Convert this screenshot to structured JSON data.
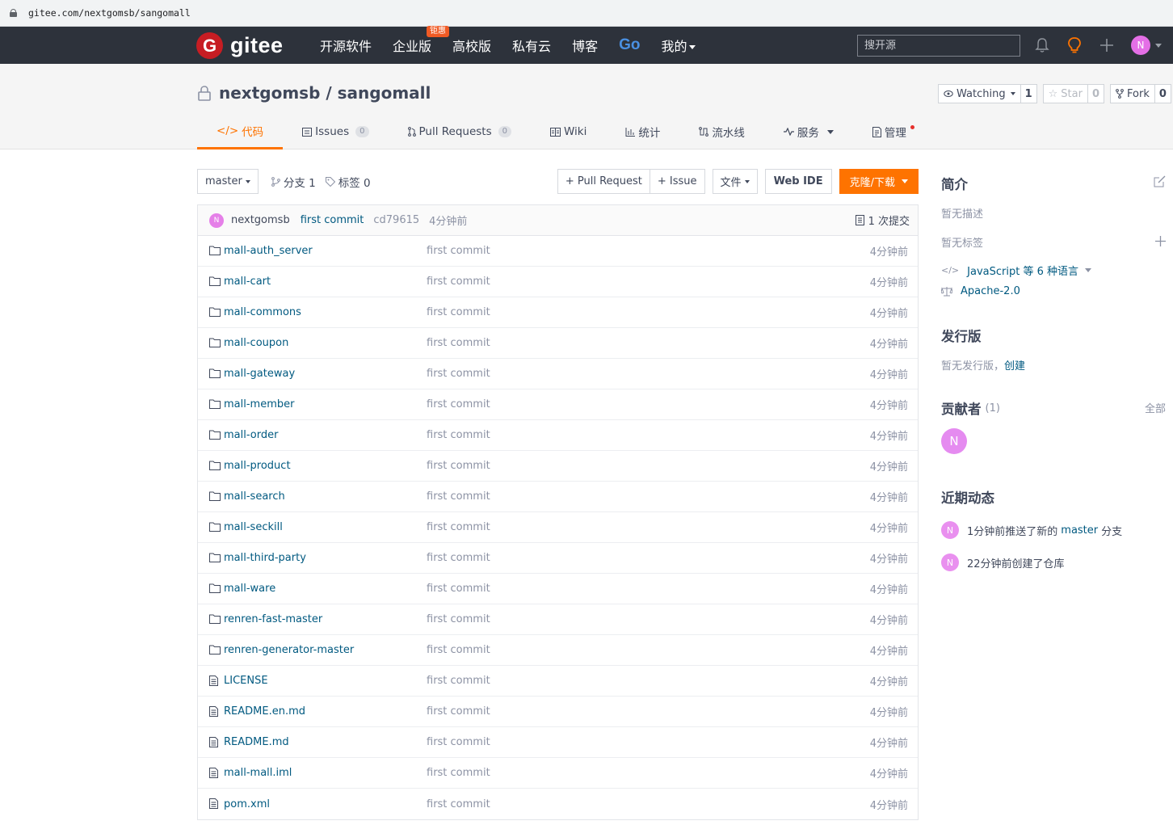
{
  "browser": {
    "url": "gitee.com/nextgomsb/sangomall"
  },
  "nav": {
    "logo_letter": "G",
    "logo_text": "gitee",
    "links": [
      "开源软件",
      "企业版",
      "高校版",
      "私有云",
      "博客",
      "Go",
      "我的"
    ],
    "enterprise_badge": "钜惠",
    "search_placeholder": "搜开源",
    "avatar_letter": "N"
  },
  "repo": {
    "owner": "nextgomsb",
    "separator": " / ",
    "name": "sangomall",
    "watch": {
      "label": "Watching",
      "count": "1"
    },
    "star": {
      "label": "Star",
      "count": "0"
    },
    "fork": {
      "label": "Fork",
      "count": "0"
    }
  },
  "tabs": [
    {
      "label": "代码"
    },
    {
      "label": "Issues",
      "count": "0"
    },
    {
      "label": "Pull Requests",
      "count": "0"
    },
    {
      "label": "Wiki"
    },
    {
      "label": "统计"
    },
    {
      "label": "流水线"
    },
    {
      "label": "服务"
    },
    {
      "label": "管理"
    }
  ],
  "toolbar": {
    "branch": "master",
    "branches": "分支 1",
    "tags": "标签 0",
    "pull_request": "+ Pull Request",
    "issue": "+ Issue",
    "file": "文件",
    "web_ide": "Web IDE",
    "clone": "克隆/下载"
  },
  "commit": {
    "avatar_letter": "N",
    "author": "nextgomsb",
    "message": "first commit",
    "sha": "cd79615",
    "time": "4分钟前",
    "count": "1 次提交"
  },
  "files": [
    {
      "name": "mall-auth_server",
      "type": "folder",
      "message": "first commit",
      "time": "4分钟前"
    },
    {
      "name": "mall-cart",
      "type": "folder",
      "message": "first commit",
      "time": "4分钟前"
    },
    {
      "name": "mall-commons",
      "type": "folder",
      "message": "first commit",
      "time": "4分钟前"
    },
    {
      "name": "mall-coupon",
      "type": "folder",
      "message": "first commit",
      "time": "4分钟前"
    },
    {
      "name": "mall-gateway",
      "type": "folder",
      "message": "first commit",
      "time": "4分钟前"
    },
    {
      "name": "mall-member",
      "type": "folder",
      "message": "first commit",
      "time": "4分钟前"
    },
    {
      "name": "mall-order",
      "type": "folder",
      "message": "first commit",
      "time": "4分钟前"
    },
    {
      "name": "mall-product",
      "type": "folder",
      "message": "first commit",
      "time": "4分钟前"
    },
    {
      "name": "mall-search",
      "type": "folder",
      "message": "first commit",
      "time": "4分钟前"
    },
    {
      "name": "mall-seckill",
      "type": "folder",
      "message": "first commit",
      "time": "4分钟前"
    },
    {
      "name": "mall-third-party",
      "type": "folder",
      "message": "first commit",
      "time": "4分钟前"
    },
    {
      "name": "mall-ware",
      "type": "folder",
      "message": "first commit",
      "time": "4分钟前"
    },
    {
      "name": "renren-fast-master",
      "type": "folder",
      "message": "first commit",
      "time": "4分钟前"
    },
    {
      "name": "renren-generator-master",
      "type": "folder",
      "message": "first commit",
      "time": "4分钟前"
    },
    {
      "name": "LICENSE",
      "type": "file",
      "message": "first commit",
      "time": "4分钟前"
    },
    {
      "name": "README.en.md",
      "type": "file",
      "message": "first commit",
      "time": "4分钟前"
    },
    {
      "name": "README.md",
      "type": "file",
      "message": "first commit",
      "time": "4分钟前"
    },
    {
      "name": "mall-mall.iml",
      "type": "file",
      "message": "first commit",
      "time": "4分钟前"
    },
    {
      "name": "pom.xml",
      "type": "file",
      "message": "first commit",
      "time": "4分钟前"
    }
  ],
  "sidebar": {
    "intro_title": "简介",
    "no_desc": "暂无描述",
    "no_tags": "暂无标签",
    "languages": "JavaScript 等 6 种语言",
    "license": "Apache-2.0",
    "release_title": "发行版",
    "no_release": "暂无发行版，",
    "create": "创建",
    "contrib_title": "贡献者",
    "contrib_count": "(1)",
    "all": "全部",
    "contrib_letter": "N",
    "activity_title": "近期动态",
    "activities": [
      {
        "letter": "N",
        "prefix": "1分钟前推送了新的",
        "branch": "master",
        "suffix": "分支"
      },
      {
        "letter": "N",
        "text": "22分钟前创建了仓库"
      }
    ]
  }
}
